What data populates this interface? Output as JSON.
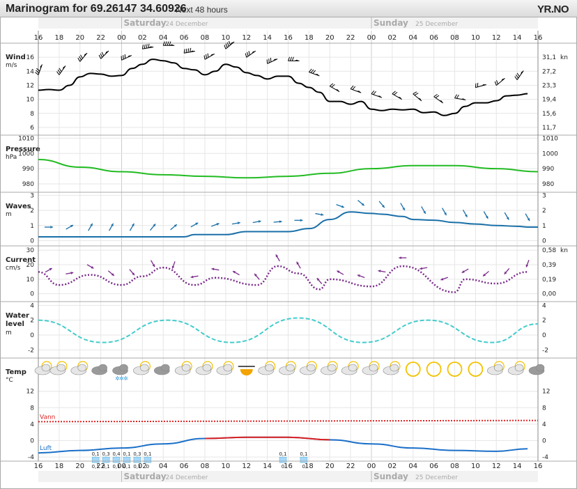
{
  "header": {
    "title": "Marinogram for 69.26147 34.60926",
    "subtitle": "Next 48 hours",
    "logo": "YR.NO"
  },
  "days": [
    {
      "name": "Saturday",
      "date": "24 December"
    },
    {
      "name": "Sunday",
      "date": "25 December"
    }
  ],
  "hour_labels": [
    "16",
    "18",
    "20",
    "22",
    "00",
    "02",
    "04",
    "06",
    "08",
    "10",
    "12",
    "14",
    "16",
    "18",
    "20",
    "22",
    "00",
    "02",
    "04",
    "06",
    "08",
    "10",
    "12",
    "14",
    "16"
  ],
  "colors": {
    "wind": "#000000",
    "pressure": "#22bb22",
    "waves": "#1a6fa8",
    "current": "#7a2a8a",
    "water_level": "#44cccc",
    "water_temp": "#dd2222",
    "air_warm": "#dd2222",
    "air_cold": "#1a6fc8"
  },
  "chart_data": [
    {
      "type": "line",
      "panel": "wind",
      "label": "Wind",
      "unit": "m/s",
      "right_unit": "kn",
      "yticks": [
        6,
        8,
        10,
        12,
        14,
        16
      ],
      "right_ticks": [
        "11,7",
        "15,6",
        "19,4",
        "23,3",
        "27,2",
        "31,1"
      ],
      "ylim": [
        5,
        18
      ],
      "x": [
        0,
        1,
        2,
        3,
        4,
        5,
        6,
        7,
        8,
        9,
        10,
        11,
        12,
        13,
        14,
        15,
        16,
        17,
        18,
        19,
        20,
        21,
        22,
        23,
        24,
        25,
        26,
        27,
        28,
        29,
        30,
        31,
        32,
        33,
        34,
        35,
        36,
        37,
        38,
        39,
        40,
        41,
        42,
        43,
        44,
        45,
        46,
        47
      ],
      "values": [
        11.3,
        11.4,
        11.3,
        12,
        13.2,
        13.7,
        13.6,
        13.3,
        13.4,
        14.4,
        15,
        15.7,
        15.5,
        15.2,
        14.4,
        14.2,
        13.5,
        14,
        15,
        14.6,
        13.8,
        13.4,
        12.9,
        13.3,
        13.3,
        12.3,
        11.7,
        11,
        9.7,
        9.7,
        9.3,
        9.7,
        8.6,
        8.4,
        8.6,
        8.5,
        8.6,
        8.1,
        8.2,
        7.7,
        8,
        9,
        9.5,
        9.5,
        9.8,
        10.5,
        10.6,
        10.8
      ],
      "direction_deg": [
        20,
        25,
        35,
        40,
        40,
        45,
        45,
        60,
        65,
        75,
        80,
        90,
        90,
        85,
        80,
        70,
        60,
        55,
        50,
        55,
        55,
        60,
        65,
        80,
        90,
        100,
        110,
        120,
        120,
        115,
        110,
        105,
        110,
        115,
        120,
        125,
        130,
        130,
        125,
        115,
        100,
        85,
        75,
        65,
        50,
        40,
        35,
        20
      ]
    },
    {
      "type": "line",
      "panel": "pressure",
      "label": "Pressure",
      "unit": "hPa",
      "yticks": [
        980,
        990,
        1000,
        1010
      ],
      "right_ticks": [
        "980",
        "990",
        "1000",
        "1010"
      ],
      "ylim": [
        975,
        1012
      ],
      "x": [
        0,
        4,
        8,
        12,
        16,
        20,
        24,
        28,
        32,
        36,
        40,
        44,
        48
      ],
      "values": [
        996,
        991,
        988,
        986,
        985,
        984,
        985,
        987,
        990,
        992,
        992,
        990,
        988
      ]
    },
    {
      "type": "line",
      "panel": "waves",
      "label": "Waves",
      "unit": "m",
      "yticks": [
        0,
        1,
        2,
        3
      ],
      "right_ticks": [
        "0",
        "1",
        "2",
        "3"
      ],
      "ylim": [
        -0.3,
        3.2
      ],
      "x": [
        0,
        14,
        15,
        18,
        20,
        24,
        26,
        28,
        30,
        32,
        33,
        35,
        36,
        38,
        40,
        42,
        44,
        46,
        47,
        48
      ],
      "values": [
        0.25,
        0.25,
        0.4,
        0.4,
        0.6,
        0.6,
        0.8,
        1.4,
        1.9,
        1.8,
        1.75,
        1.6,
        1.4,
        1.35,
        1.2,
        1.1,
        1.0,
        0.95,
        0.9,
        0.9
      ],
      "direction_deg": [
        90,
        60,
        30,
        30,
        30,
        40,
        50,
        60,
        70,
        80,
        80,
        85,
        90,
        100,
        110,
        130,
        140,
        150,
        150,
        150,
        150,
        150,
        150,
        150
      ]
    },
    {
      "type": "line",
      "panel": "current",
      "label": "Current",
      "unit": "cm/s",
      "right_unit": "kn",
      "yticks": [
        0,
        10,
        20,
        30
      ],
      "right_ticks": [
        "0,00",
        "0,19",
        "0,39",
        "0,58"
      ],
      "ylim": [
        -5,
        33
      ],
      "x": [
        0,
        2,
        5,
        8,
        10,
        12,
        15,
        17,
        21,
        23,
        25,
        27,
        28,
        32,
        35,
        40,
        41,
        44,
        47
      ],
      "values": [
        15,
        6,
        13,
        6,
        12,
        18,
        6,
        11,
        6,
        19,
        14,
        3,
        10,
        5,
        19,
        1,
        10,
        7,
        15
      ],
      "direction_deg": [
        60,
        80,
        120,
        130,
        140,
        150,
        200,
        260,
        280,
        300,
        320,
        330,
        330,
        320,
        300,
        290,
        280,
        270,
        260,
        250,
        240,
        230,
        220,
        200
      ]
    },
    {
      "type": "line",
      "panel": "water_level",
      "label": "Water level",
      "unit": "m",
      "yticks": [
        -2,
        0,
        2,
        4
      ],
      "right_ticks": [
        "-2",
        "0",
        "2",
        "4"
      ],
      "ylim": [
        -3,
        4.5
      ],
      "x": [
        0,
        6.2,
        12.4,
        18.6,
        25,
        31.2,
        37.4,
        43.6,
        48
      ],
      "values": [
        2,
        -1,
        2,
        -1,
        2.3,
        -1,
        2,
        -1,
        1.5
      ]
    },
    {
      "type": "line",
      "panel": "temp",
      "label": "Temp",
      "unit": "°C",
      "yticks": [
        -4,
        0,
        4,
        8,
        12
      ],
      "right_ticks": [
        "-4",
        "0",
        "4",
        "8",
        "12"
      ],
      "ylim": [
        -5,
        15
      ],
      "series": [
        {
          "name": "Vann",
          "x": [
            0,
            48
          ],
          "values": [
            4.6,
            4.9
          ]
        },
        {
          "name": "Luft",
          "x": [
            0,
            4,
            8,
            12,
            16,
            20,
            24,
            28,
            32,
            36,
            40,
            44,
            47
          ],
          "values": [
            -3,
            -2.4,
            -1.8,
            -0.8,
            0.5,
            0.8,
            0.8,
            0.2,
            -0.8,
            -1.8,
            -2.4,
            -2.6,
            -2
          ]
        }
      ],
      "precip": [
        {
          "x": 5.5,
          "max": "0,1",
          "min": "0,1"
        },
        {
          "x": 6.5,
          "max": "0,3",
          "min": "0,1"
        },
        {
          "x": 7.5,
          "max": "0,4",
          "min": "0,1"
        },
        {
          "x": 8.5,
          "max": "0,1",
          "min": "0,1"
        },
        {
          "x": 9.5,
          "max": "0,3",
          "min": "0,1"
        },
        {
          "x": 10.5,
          "max": "0,1",
          "min": "0"
        },
        {
          "x": 23.5,
          "max": "0,1",
          "min": "0"
        },
        {
          "x": 25.5,
          "max": "0,1",
          "min": "0"
        }
      ],
      "weather_icons": [
        "partly-cloudy-icon",
        "partly-cloudy-icon",
        "partly-cloudy-icon",
        "cloudy-icon",
        "snow-icon",
        "partly-cloudy-icon",
        "cloudy-icon",
        "partly-cloudy-icon",
        "partly-cloudy-icon",
        "partly-cloudy-icon",
        "sunset-icon",
        "partly-cloudy-icon",
        "partly-cloudy-icon",
        "partly-cloudy-icon",
        "partly-cloudy-icon",
        "partly-cloudy-icon",
        "partly-cloudy-icon",
        "partly-cloudy-icon",
        "clear-icon",
        "clear-icon",
        "clear-icon",
        "clear-icon",
        "partly-cloudy-icon",
        "partly-cloudy-icon",
        "cloudy-icon"
      ]
    }
  ]
}
